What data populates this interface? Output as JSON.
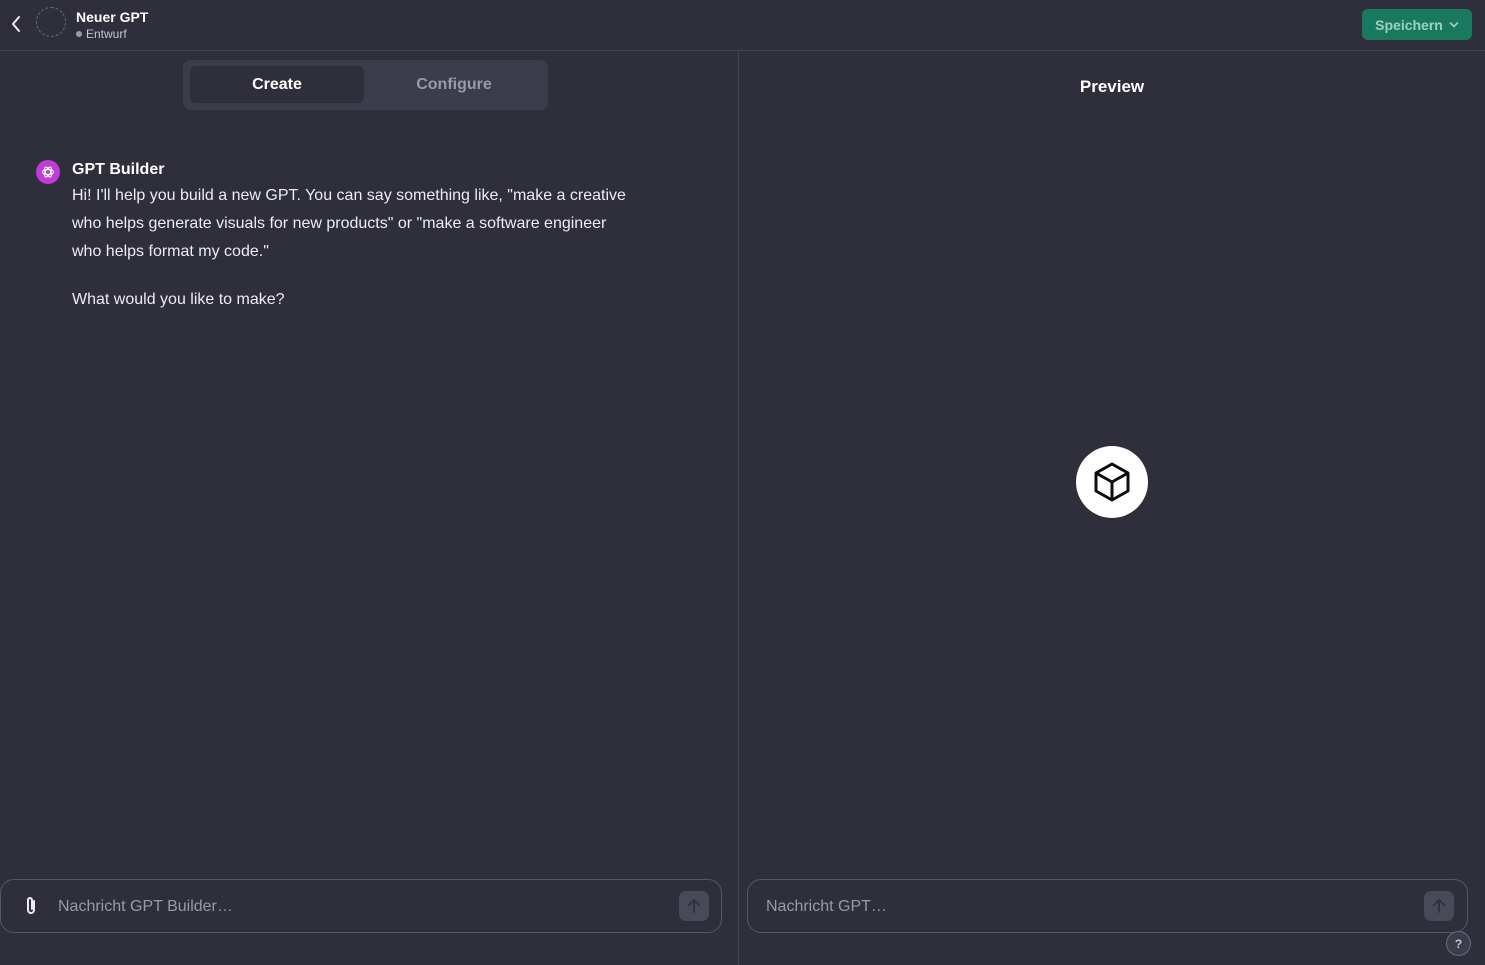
{
  "header": {
    "title": "Neuer GPT",
    "status": "Entwurf",
    "save_label": "Speichern"
  },
  "tabs": [
    {
      "label": "Create",
      "active": true
    },
    {
      "label": "Configure",
      "active": false
    }
  ],
  "chat": {
    "sender": "GPT Builder",
    "message_1": "Hi! I'll help you build a new GPT. You can say something like, \"make a creative who helps generate visuals for new products\" or \"make a software engineer who helps format my code.\"",
    "message_2": "What would you like to make?",
    "input_placeholder": "Nachricht GPT Builder…"
  },
  "preview": {
    "title": "Preview",
    "logo_icon": "cube-icon",
    "input_placeholder": "Nachricht GPT…"
  },
  "help_label": "?",
  "colors": {
    "background": "#2f2e3b",
    "accent": "#19795f",
    "builder_avatar": "#c03bd8"
  }
}
